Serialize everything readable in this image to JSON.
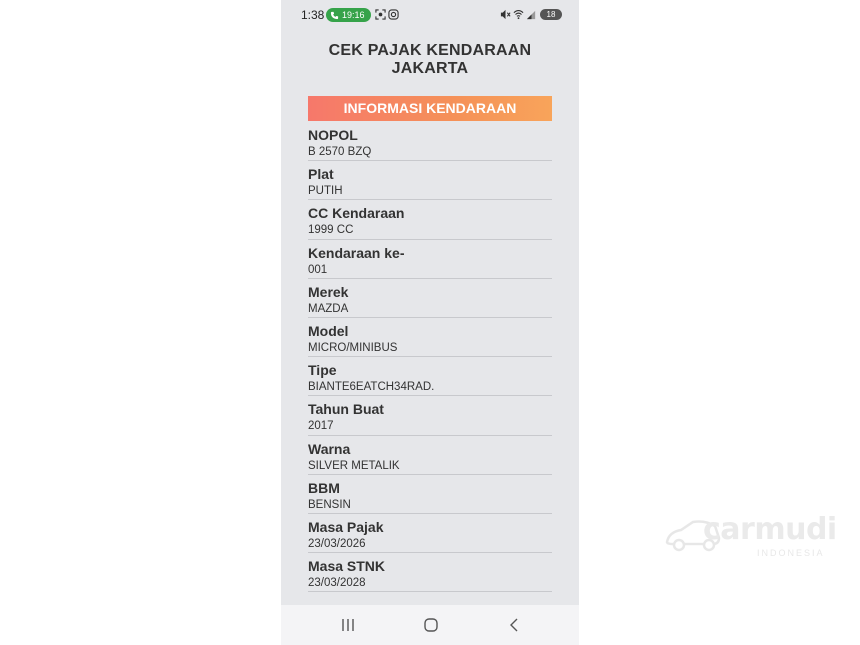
{
  "status_bar": {
    "time": "1:38",
    "call_duration": "19:16",
    "battery": "18"
  },
  "app": {
    "title_line1": "CEK PAJAK KENDARAAN",
    "title_line2": "JAKARTA"
  },
  "section": {
    "header": "INFORMASI KENDARAAN",
    "header_colors": [
      "#f6786b",
      "#f8a45a"
    ]
  },
  "fields": [
    {
      "label": "NOPOL",
      "value": "B 2570 BZQ"
    },
    {
      "label": "Plat",
      "value": "PUTIH"
    },
    {
      "label": "CC Kendaraan",
      "value": "1999 CC"
    },
    {
      "label": "Kendaraan ke-",
      "value": "001"
    },
    {
      "label": "Merek",
      "value": "MAZDA"
    },
    {
      "label": "Model",
      "value": "MICRO/MINIBUS"
    },
    {
      "label": "Tipe",
      "value": "BIANTE6EATCH34RAD."
    },
    {
      "label": "Tahun Buat",
      "value": "2017"
    },
    {
      "label": "Warna",
      "value": "SILVER METALIK"
    },
    {
      "label": "BBM",
      "value": "BENSIN"
    },
    {
      "label": "Masa Pajak",
      "value": "23/03/2026"
    },
    {
      "label": "Masa STNK",
      "value": "23/03/2028"
    }
  ],
  "nav": {
    "recents_icon": "recents-icon",
    "home_icon": "home-icon",
    "back_icon": "back-icon"
  },
  "watermark": {
    "brand": "carmudi",
    "sub": "INDONESIA"
  }
}
